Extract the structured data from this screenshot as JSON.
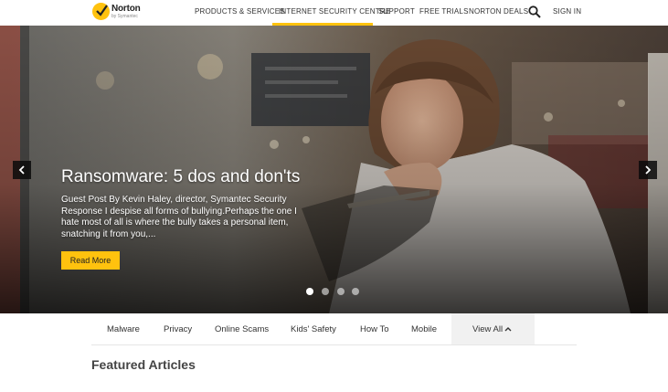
{
  "brand": {
    "name": "Norton",
    "tagline": "by Symantec",
    "accent": "#ffc20e"
  },
  "nav": {
    "items": [
      {
        "label": "PRODUCTS & SERVICES"
      },
      {
        "label": "INTERNET SECURITY CENTRE",
        "active": true
      },
      {
        "label": "SUPPORT"
      },
      {
        "label": "FREE TRIALS"
      },
      {
        "label": "NORTON DEALS"
      }
    ],
    "search_icon": "search-icon",
    "sign_in": "SIGN IN"
  },
  "hero": {
    "title": "Ransomware: 5 dos and don'ts",
    "text": "Guest Post By Kevin Haley, director, Symantec Security Response I despise all forms of bullying.Perhaps the one I hate most of all is where the bully takes a personal item, snatching it from you,...",
    "cta": "Read More",
    "slides_total": 4,
    "active_slide": 1
  },
  "categories": {
    "items": [
      "Malware",
      "Privacy",
      "Online Scams",
      "Kids' Safety",
      "How To",
      "Mobile"
    ],
    "view_all": "View All"
  },
  "featured_heading": "Featured Articles"
}
